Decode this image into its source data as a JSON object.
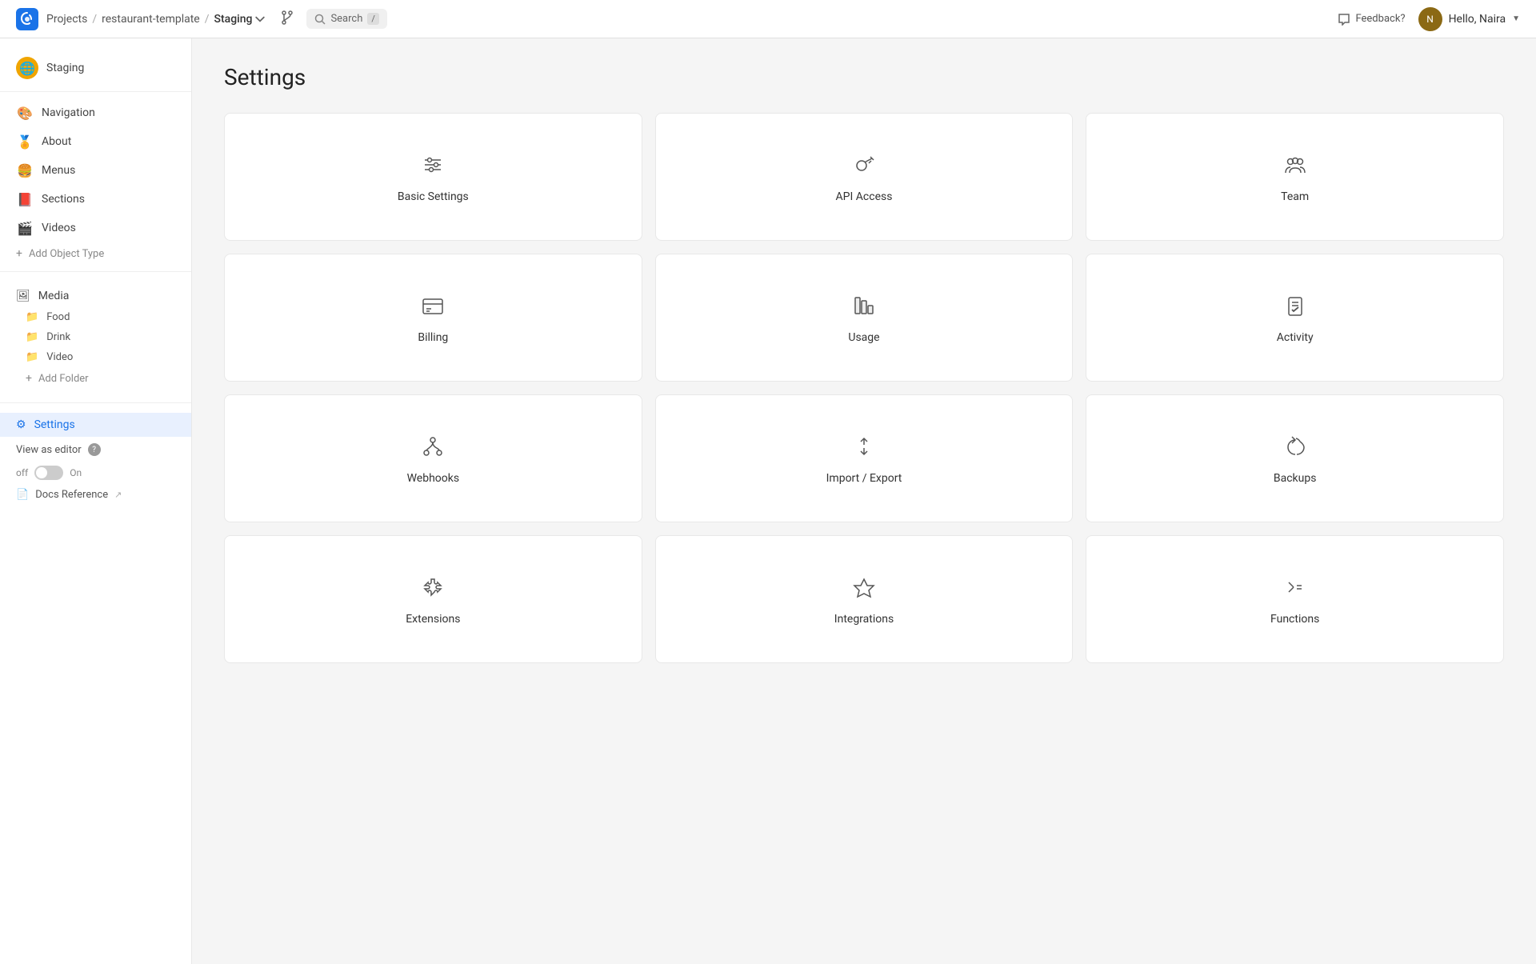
{
  "topnav": {
    "logo_alt": "Cosmic JS",
    "breadcrumb": [
      {
        "label": "Projects",
        "href": "#"
      },
      {
        "label": "restaurant-template",
        "href": "#"
      },
      {
        "label": "Staging",
        "href": "#",
        "has_dropdown": true
      }
    ],
    "search_label": "Search",
    "search_shortcut": "/",
    "feedback_label": "Feedback?",
    "user_label": "Hello, Naira",
    "user_avatar_initials": "N"
  },
  "sidebar": {
    "environment_icon": "🌐",
    "environment_label": "Staging",
    "nav_items": [
      {
        "id": "navigation",
        "icon": "🎨",
        "label": "Navigation"
      },
      {
        "id": "about",
        "icon": "🏅",
        "label": "About"
      },
      {
        "id": "menus",
        "icon": "🍔",
        "label": "Menus"
      },
      {
        "id": "sections",
        "icon": "📕",
        "label": "Sections"
      },
      {
        "id": "videos",
        "icon": "🎬",
        "label": "Videos"
      }
    ],
    "add_object_label": "Add Object Type",
    "media_label": "Media",
    "folders": [
      {
        "id": "food",
        "label": "Food"
      },
      {
        "id": "drink",
        "label": "Drink"
      },
      {
        "id": "video",
        "label": "Video"
      }
    ],
    "add_folder_label": "Add Folder",
    "settings_label": "Settings",
    "view_as_editor_label": "View as editor",
    "toggle_off_label": "off",
    "toggle_on_label": "On",
    "docs_label": "Docs Reference"
  },
  "main": {
    "page_title": "Settings",
    "cards": [
      {
        "id": "basic-settings",
        "label": "Basic Settings",
        "icon": "sliders"
      },
      {
        "id": "api-access",
        "label": "API Access",
        "icon": "key"
      },
      {
        "id": "team",
        "label": "Team",
        "icon": "team"
      },
      {
        "id": "billing",
        "label": "Billing",
        "icon": "billing"
      },
      {
        "id": "usage",
        "label": "Usage",
        "icon": "usage"
      },
      {
        "id": "activity",
        "label": "Activity",
        "icon": "activity"
      },
      {
        "id": "webhooks",
        "label": "Webhooks",
        "icon": "webhooks"
      },
      {
        "id": "import-export",
        "label": "Import / Export",
        "icon": "import-export"
      },
      {
        "id": "backups",
        "label": "Backups",
        "icon": "backups"
      },
      {
        "id": "extensions",
        "label": "Extensions",
        "icon": "extensions"
      },
      {
        "id": "integrations",
        "label": "Integrations",
        "icon": "integrations"
      },
      {
        "id": "functions",
        "label": "Functions",
        "icon": "functions"
      }
    ]
  }
}
